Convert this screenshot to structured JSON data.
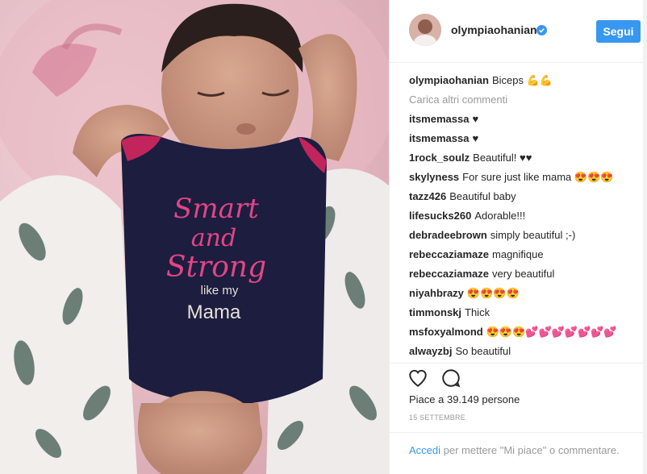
{
  "post": {
    "username": "olympiaohanian",
    "follow_label": "Segui",
    "caption_user": "olympiaohanian",
    "caption_text": "Biceps 💪💪",
    "load_more": "Carica altri commenti",
    "comments": [
      {
        "user": "itsmemassa",
        "text": "♥"
      },
      {
        "user": "itsmemassa",
        "text": "♥"
      },
      {
        "user": "1rock_soulz",
        "text": "Beautiful! ♥♥"
      },
      {
        "user": "skylyness",
        "text": "For sure just like mama 😍😍😍"
      },
      {
        "user": "tazz426",
        "text": "Beautiful baby"
      },
      {
        "user": "lifesucks260",
        "text": "Adorable!!!"
      },
      {
        "user": "debradeebrown",
        "text": "simply beautiful ;-)"
      },
      {
        "user": "rebeccaziamaze",
        "text": "magnifique"
      },
      {
        "user": "rebeccaziamaze",
        "text": "very beautiful"
      },
      {
        "user": "niyahbrazy",
        "text": "😍😍😍😍"
      },
      {
        "user": "timmonskj",
        "text": "Thick"
      },
      {
        "user": "msfoxyalmond",
        "text": "😍😍😍💕💕💕💕💕💕💕"
      },
      {
        "user": "alwayzbj",
        "text": "So beautiful"
      }
    ],
    "likes_text": "Piace a 39.149 persone",
    "date": "15 SETTEMBRE",
    "login_link": "Accedi",
    "login_rest": " per mettere \"Mi piace\" o commentare."
  },
  "photo": {
    "onesie_line1": "Smart",
    "onesie_line2": "and",
    "onesie_line3": "Strong",
    "onesie_line4": "like my",
    "onesie_line5": "Mama"
  },
  "colors": {
    "accent": "#3897f0",
    "verified": "#3897f0"
  },
  "icons": {
    "like": "heart-icon",
    "comment": "comment-bubble-icon",
    "verified": "verified-badge-icon"
  }
}
